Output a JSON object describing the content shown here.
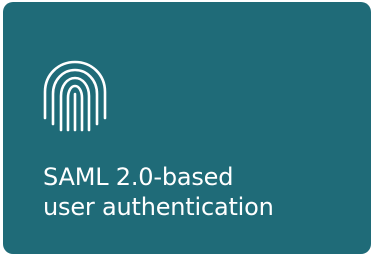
{
  "card": {
    "background": "#1f6b78",
    "icon": "fingerprint-icon",
    "title_line1": "SAML 2.0-based",
    "title_line2": "user authentication"
  }
}
